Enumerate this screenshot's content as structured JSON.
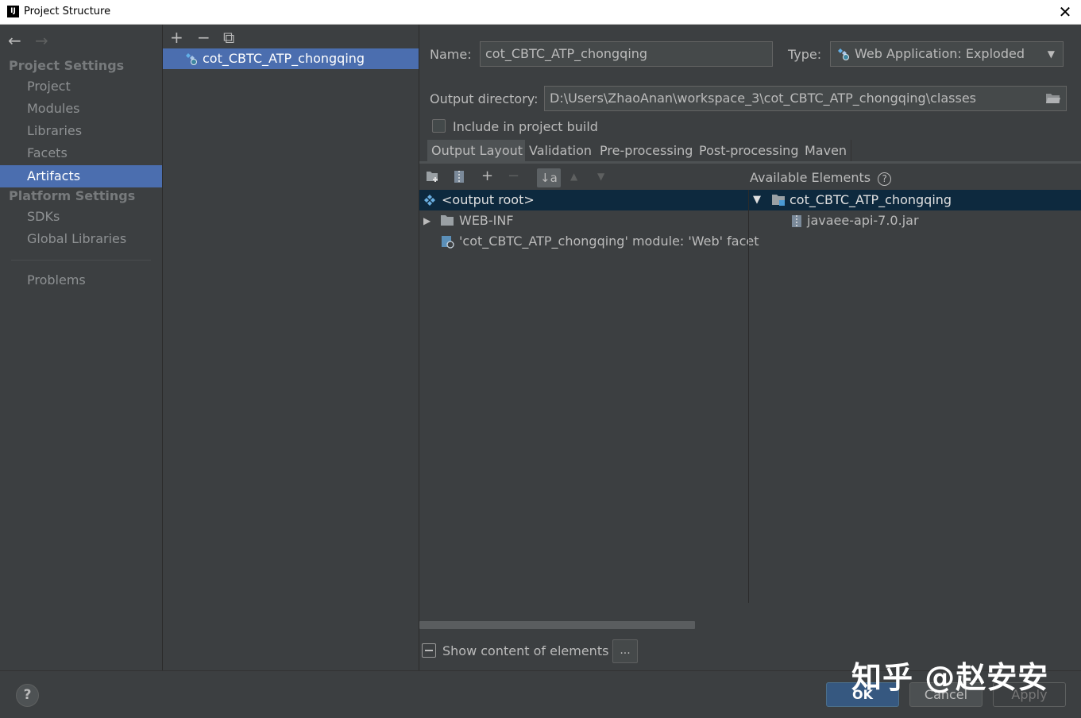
{
  "window": {
    "title": "Project Structure",
    "close_glyph": "✕",
    "app_icon_text": "IJ"
  },
  "sidebar": {
    "back": "←",
    "forward": "→",
    "project_settings_title": "Project Settings",
    "platform_settings_title": "Platform Settings",
    "items": [
      {
        "label": "Project"
      },
      {
        "label": "Modules"
      },
      {
        "label": "Libraries"
      },
      {
        "label": "Facets"
      },
      {
        "label": "Artifacts",
        "selected": true
      },
      {
        "label": "SDKs"
      },
      {
        "label": "Global Libraries"
      },
      {
        "label": "Problems"
      }
    ]
  },
  "artifacts_panel": {
    "toolbar": {
      "add": "+",
      "remove": "−",
      "copy": "⧉"
    },
    "items": [
      {
        "label": "cot_CBTC_ATP_chongqing",
        "selected": true
      }
    ]
  },
  "config": {
    "name_label": "Name:",
    "name_value": "cot_CBTC_ATP_chongqing",
    "type_label": "Type:",
    "type_value": "Web Application: Exploded",
    "output_dir_label": "Output directory:",
    "output_dir_value": "D:\\Users\\ZhaoAnan\\workspace_3\\cot_CBTC_ATP_chongqing\\classes",
    "include_in_build_label": "Include in project build",
    "include_in_build_checked": false,
    "tabs": [
      {
        "label": "Output Layout",
        "active": true
      },
      {
        "label": "Validation"
      },
      {
        "label": "Pre-processing"
      },
      {
        "label": "Post-processing"
      },
      {
        "label": "Maven"
      }
    ],
    "layout": {
      "toolbar": {
        "add": "+",
        "remove": "−",
        "sort": "↓a",
        "up": "▲",
        "down": "▼"
      },
      "tree": [
        {
          "label": "<output root>",
          "selected": true
        },
        {
          "label": "WEB-INF",
          "expander": "▶"
        },
        {
          "label": "'cot_CBTC_ATP_chongqing' module: 'Web' facet"
        }
      ],
      "available_title": "Available Elements",
      "available_help": "?",
      "available_tree": [
        {
          "label": "cot_CBTC_ATP_chongqing",
          "expander": "▼",
          "selected": true
        },
        {
          "label": "javaee-api-7.0.jar"
        }
      ]
    },
    "show_content_label": "Show content of elements",
    "dots_button": "..."
  },
  "footer": {
    "help": "?",
    "ok": "OK",
    "cancel": "Cancel",
    "apply": "Apply",
    "watermark": "知乎 @赵安安"
  },
  "colors": {
    "background": "#3c3f41",
    "selection": "#4b6eaf",
    "tree_selection": "#0d293e",
    "ok_button": "#365880"
  }
}
